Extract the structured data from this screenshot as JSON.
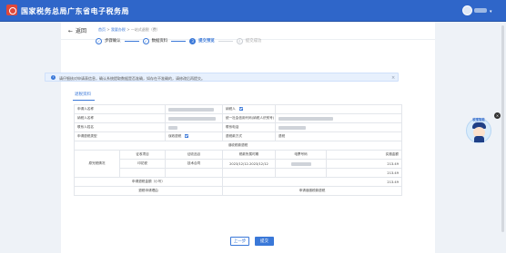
{
  "header": {
    "title": "国家税务总局广东省电子税务局",
    "colors": {
      "brand": "#2f66c9",
      "logo": "#e0473a"
    }
  },
  "topbar": {
    "back_label": "返回",
    "breadcrumb": [
      "首页",
      "我要办税",
      "一站式退税（费）"
    ]
  },
  "steps": [
    {
      "num": "✓",
      "label": "步骤确认",
      "state": "done"
    },
    {
      "num": "✓",
      "label": "数据资料",
      "state": "done"
    },
    {
      "num": "3",
      "label": "提交预览",
      "state": "current"
    },
    {
      "num": "4",
      "label": "提交成功",
      "state": "todo"
    }
  ],
  "alert": {
    "icon": "info-icon",
    "message": "请仔细核对申请表信息，确认系统提取数据是否准确，如存在不准确的，请修改后再提交。",
    "close": "×"
  },
  "tab": {
    "label": "退税资料"
  },
  "form": {
    "r1": {
      "l1": "申请人名称",
      "l2": "纳税人"
    },
    "r2": {
      "l1": "纳税人名称",
      "l2": "统一社会信用代码(纳税人识别号)"
    },
    "r3": {
      "l1": "联系人姓名",
      "l2": "联系电话"
    },
    "r4": {
      "l1": "申请退税类型",
      "v1": "误收退税",
      "l2": "退税款方式",
      "v2": "退税"
    },
    "r5": {
      "label": "误收税款退税"
    },
    "r6": {
      "group": "原完税情况",
      "c1": "征收项目",
      "c2": "征收品目",
      "c3": "税款所属时期",
      "c4": "电票号码",
      "c5": "实缴金额"
    },
    "r7": {
      "c1": "印花税",
      "c2": "技术合同",
      "c3": "2023/12/12-2023/12/12",
      "c5": "213.49"
    },
    "r8": {
      "c5": "213.49"
    },
    "r9": {
      "label": "申请退税金额（小写）",
      "value": "213.49"
    },
    "r10": {
      "l1": "退税申请理由",
      "v1": "申请误缴税款退税"
    }
  },
  "buttons": {
    "prev": "上一步",
    "submit": "提交"
  },
  "side": {
    "close": "×",
    "robot_label": "税宝智能"
  }
}
